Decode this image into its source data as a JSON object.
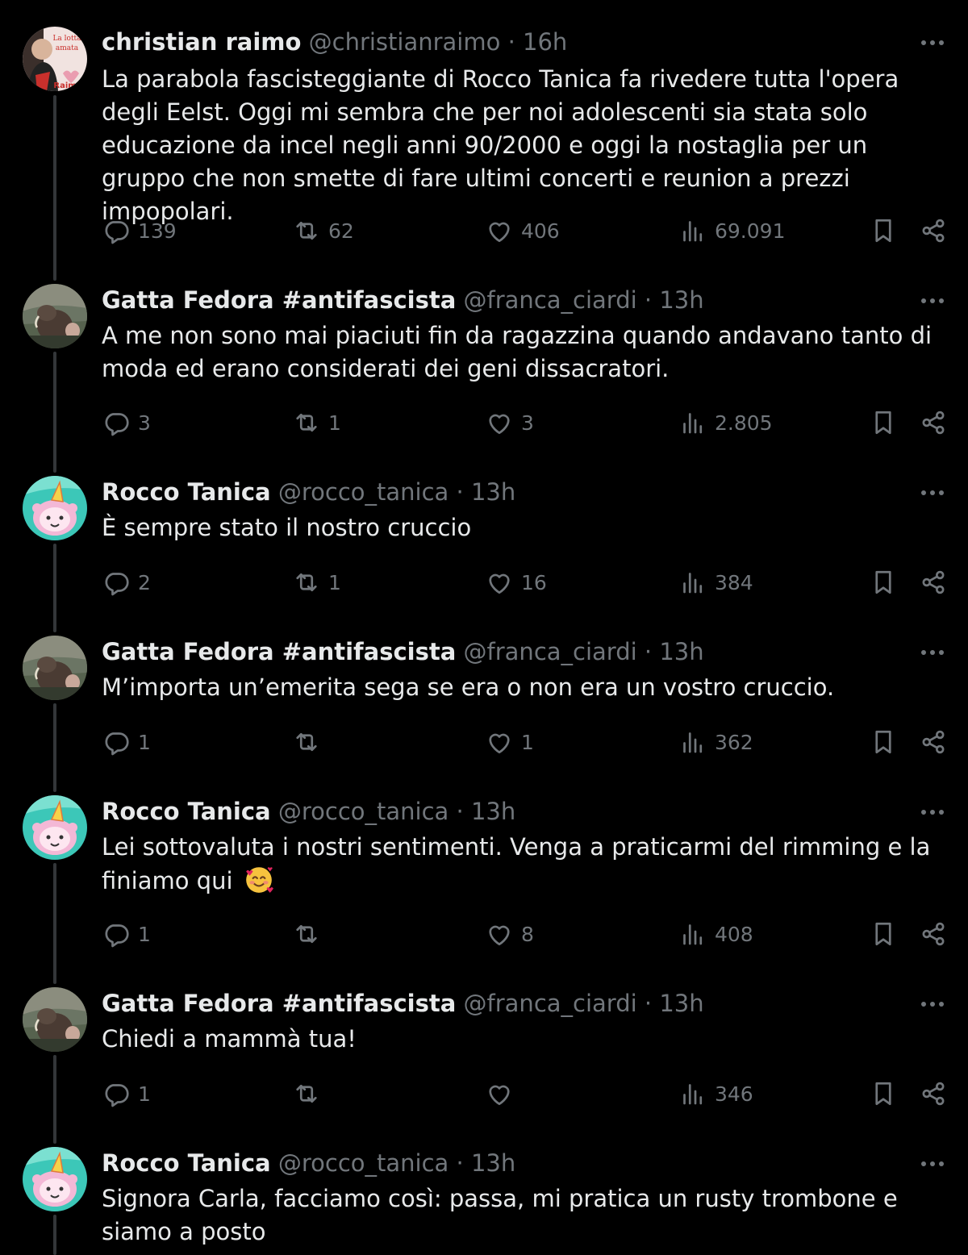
{
  "tweets": [
    {
      "name": "christian raimo",
      "handle": "@christianraimo",
      "separator": "·",
      "time": "16h",
      "text": "La parabola fascisteggiante di Rocco Tanica fa rivedere tutta l'opera degli Eelst. Oggi mi sembra che per noi adolescenti sia stata solo educazione da incel negli anni 90/2000 e oggi la nostaglia per un gruppo che non smette di fare ultimi concerti e reunion a prezzi impopolari.",
      "avatar_text": [
        "La lotta",
        "amata",
        "Raimo"
      ],
      "replies": "139",
      "reposts": "62",
      "likes": "406",
      "views": "69.091"
    },
    {
      "name": "Gatta Fedora #antifascista",
      "handle": "@franca_ciardi",
      "separator": "·",
      "time": "13h",
      "text": "A me non sono mai piaciuti fin da ragazzina quando andavano tanto di moda ed erano considerati dei geni dissacratori.",
      "replies": "3",
      "reposts": "1",
      "likes": "3",
      "views": "2.805"
    },
    {
      "name": "Rocco Tanica",
      "handle": "@rocco_tanica",
      "separator": "·",
      "time": "13h",
      "text": "È sempre stato il nostro cruccio",
      "replies": "2",
      "reposts": "1",
      "likes": "16",
      "views": "384"
    },
    {
      "name": "Gatta Fedora #antifascista",
      "handle": "@franca_ciardi",
      "separator": "·",
      "time": "13h",
      "text": "M’importa un’emerita sega se era o non era un vostro cruccio.",
      "replies": "1",
      "reposts": "",
      "likes": "1",
      "views": "362"
    },
    {
      "name": "Rocco Tanica",
      "handle": "@rocco_tanica",
      "separator": "·",
      "time": "13h",
      "text": "Lei sottovaluta i nostri sentimenti. Venga a praticarmi del rimming e la finiamo qui",
      "emoji": "smiling-face-with-hearts",
      "replies": "1",
      "reposts": "",
      "likes": "8",
      "views": "408"
    },
    {
      "name": "Gatta Fedora #antifascista",
      "handle": "@franca_ciardi",
      "separator": "·",
      "time": "13h",
      "text": "Chiedi a mammà tua!",
      "replies": "1",
      "reposts": "",
      "likes": "",
      "views": "346"
    },
    {
      "name": "Rocco Tanica",
      "handle": "@rocco_tanica",
      "separator": "·",
      "time": "13h",
      "text": "Signora Carla, facciamo così: passa, mi pratica un rusty trombone e siamo a posto"
    }
  ],
  "theme": {
    "background": "#000000",
    "text": "#e7e9ea",
    "muted": "#71767b",
    "thread_line": "#333639"
  },
  "icons": {
    "reply": "reply-icon",
    "repost": "repost-icon",
    "like": "like-icon",
    "views": "views-icon",
    "bookmark": "bookmark-icon",
    "share": "share-icon",
    "more": "more-icon"
  }
}
